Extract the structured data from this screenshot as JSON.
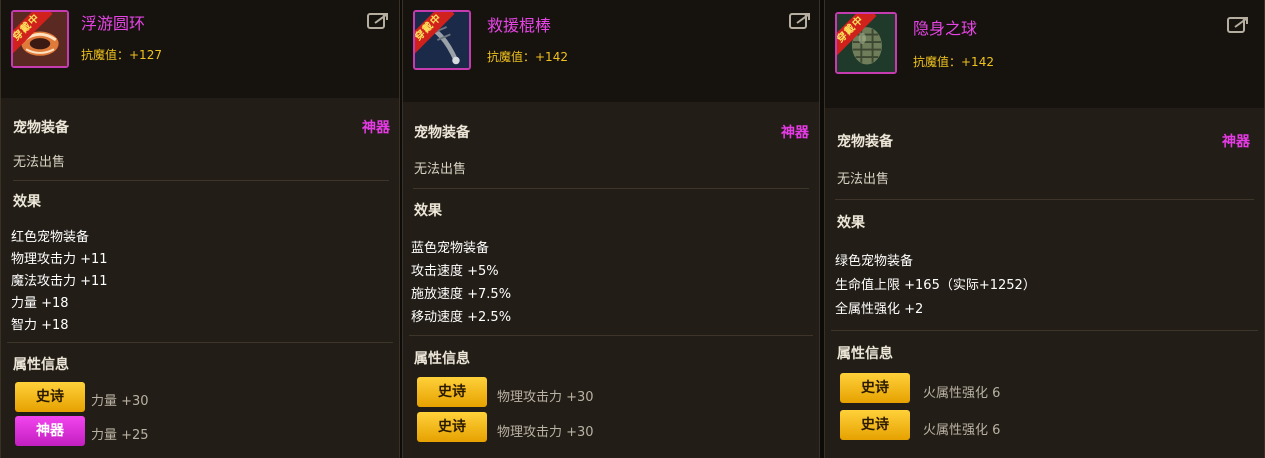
{
  "panels": [
    {
      "name": "浮游圆环",
      "stat": "抗魔值：+127",
      "equip_badge": "穿戴中",
      "category": "宠物装备",
      "rarity": "神器",
      "sell": "无法出售",
      "effects_title": "效果",
      "effects": [
        "红色宠物装备",
        "物理攻击力 +11",
        "魔法攻击力 +11",
        "力量 +18",
        "智力 +18"
      ],
      "attr_title": "属性信息",
      "attrs": [
        {
          "badge": "史诗",
          "text": "力量 +30"
        },
        {
          "badge": "神器",
          "text": "力量 +25"
        }
      ]
    },
    {
      "name": "救援棍棒",
      "stat": "抗魔值：+142",
      "equip_badge": "穿戴中",
      "category": "宠物装备",
      "rarity": "神器",
      "sell": "无法出售",
      "effects_title": "效果",
      "effects": [
        "蓝色宠物装备",
        "攻击速度 +5%",
        "施放速度 +7.5%",
        "移动速度 +2.5%"
      ],
      "attr_title": "属性信息",
      "attrs": [
        {
          "badge": "史诗",
          "text": "物理攻击力 +30"
        },
        {
          "badge": "史诗",
          "text": "物理攻击力 +30"
        }
      ]
    },
    {
      "name": "隐身之球",
      "stat": "抗魔值：+142",
      "equip_badge": "穿戴中",
      "category": "宠物装备",
      "rarity": "神器",
      "sell": "无法出售",
      "effects_title": "效果",
      "effects": [
        "绿色宠物装备",
        "生命值上限 +165（实际+1252）",
        "全属性强化 +2"
      ],
      "attr_title": "属性信息",
      "attrs": [
        {
          "badge": "史诗",
          "text": "火属性强化 6"
        },
        {
          "badge": "史诗",
          "text": "火属性强化 6"
        }
      ]
    }
  ],
  "colors": {
    "item_name": "#e645e6",
    "stat": "#f0c21e",
    "rarity": "#e43be4",
    "epic_badge": "#f5b400",
    "artifact_badge": "#e036e0"
  },
  "icons": [
    "share-icon",
    "float-ring-icon",
    "rescue-club-icon",
    "stealth-orb-icon"
  ]
}
